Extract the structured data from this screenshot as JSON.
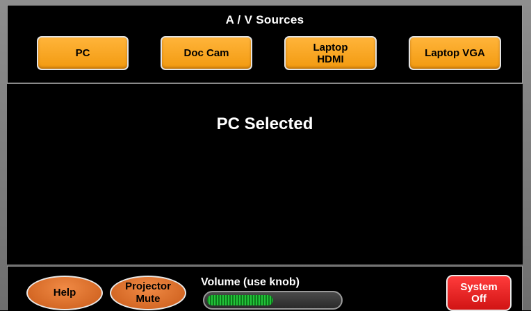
{
  "sources_panel": {
    "title": "A / V Sources",
    "buttons": [
      {
        "label": "PC"
      },
      {
        "label": "Doc Cam"
      },
      {
        "label": "Laptop\nHDMI"
      },
      {
        "label": "Laptop VGA"
      }
    ]
  },
  "main": {
    "status": "PC Selected"
  },
  "bottom_bar": {
    "help_label": "Help",
    "projector_mute_label": "Projector\nMute",
    "volume": {
      "label": "Volume (use knob)",
      "level": 0.5
    },
    "system_off_label": "System\nOff"
  },
  "colors": {
    "source_button": "#f7a31e",
    "oval_button": "#e0702a",
    "system_off": "#ee2020",
    "volume_fill": "#1fb832"
  }
}
